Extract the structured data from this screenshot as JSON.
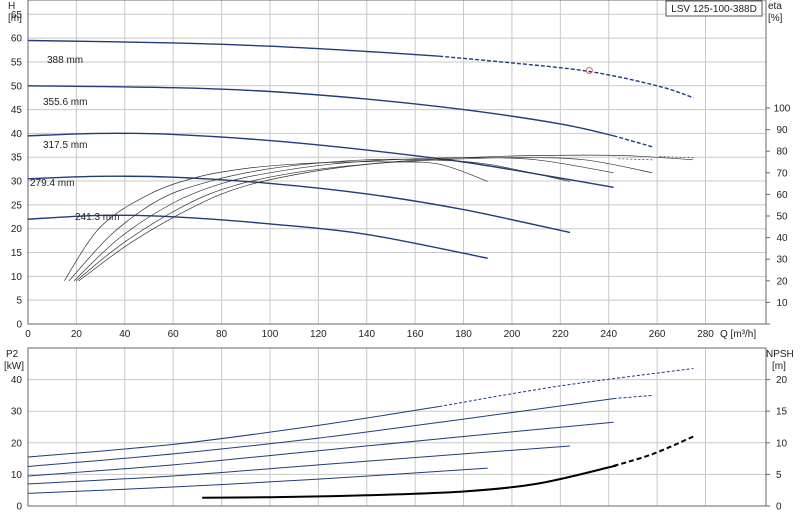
{
  "chart_title": "LSV 125-100-388D",
  "colors": {
    "curve": "#1f3d7a",
    "grid": "#c8c8c8",
    "eff": "#333333",
    "npsh": "#000000",
    "marker": "#e06060"
  },
  "top_axes": {
    "left_label": "H",
    "left_unit": "[m]",
    "right_label": "eta",
    "right_unit": "[%]",
    "x_label": "Q [m³/h]"
  },
  "bottom_axes": {
    "left_label": "P2",
    "left_unit": "[kW]",
    "right_label": "NPSH",
    "right_unit": "[m]"
  },
  "chart_data": [
    {
      "type": "line",
      "xlim": [
        0,
        305
      ],
      "ylim": [
        0,
        68
      ],
      "x_ticks": [
        "0",
        "20",
        "40",
        "60",
        "80",
        "100",
        "120",
        "140",
        "160",
        "180",
        "200",
        "220",
        "240",
        "260",
        "280"
      ],
      "y_ticks": [
        "0",
        "5",
        "10",
        "15",
        "20",
        "25",
        "30",
        "35",
        "40",
        "45",
        "50",
        "55",
        "60",
        "65"
      ],
      "eta_ticks": [
        "10",
        "20",
        "30",
        "40",
        "50",
        "60",
        "70",
        "80",
        "90",
        "100"
      ],
      "series": [
        {
          "name": "388 mm",
          "x": [
            0,
            60,
            100,
            140,
            170,
            200,
            232,
            260,
            275
          ],
          "y": [
            59.5,
            59,
            58.3,
            57.2,
            56.2,
            54.8,
            53,
            50,
            47.5
          ],
          "solid_until": 170
        },
        {
          "name": "355.6 mm",
          "x": [
            0,
            60,
            100,
            140,
            180,
            220,
            242,
            258
          ],
          "y": [
            50,
            49.6,
            48.8,
            47.2,
            45,
            42,
            39.5,
            37.2
          ],
          "solid_until": 242
        },
        {
          "name": "317.5 mm",
          "x": [
            0,
            30,
            60,
            100,
            140,
            180,
            210,
            242
          ],
          "y": [
            39.5,
            40,
            39.8,
            38.5,
            36.5,
            34,
            31.5,
            28.7
          ]
        },
        {
          "name": "279.4 mm",
          "x": [
            0,
            30,
            60,
            100,
            140,
            180,
            224
          ],
          "y": [
            30.5,
            31,
            30.8,
            29.5,
            27.3,
            24,
            19.2
          ]
        },
        {
          "name": "241.3 mm",
          "x": [
            0,
            30,
            60,
            100,
            140,
            190
          ],
          "y": [
            22,
            22.8,
            22.5,
            21,
            18.8,
            13.8
          ]
        }
      ],
      "efficiency_curves": [
        {
          "x": [
            15,
            30,
            50,
            70,
            90,
            110,
            130,
            150,
            170,
            190
          ],
          "eta": [
            20,
            45,
            60,
            68,
            72,
            74,
            75,
            75,
            74,
            66
          ]
        },
        {
          "x": [
            17,
            35,
            55,
            75,
            95,
            115,
            140,
            165,
            190,
            224
          ],
          "eta": [
            20,
            42,
            58,
            66,
            71,
            74,
            76,
            76,
            74,
            66
          ]
        },
        {
          "x": [
            19,
            38,
            60,
            80,
            100,
            125,
            150,
            180,
            210,
            242
          ],
          "eta": [
            20,
            40,
            56,
            65,
            70,
            74,
            76,
            77,
            76,
            70
          ]
        },
        {
          "x": [
            20,
            40,
            65,
            85,
            110,
            140,
            170,
            200,
            230,
            258
          ],
          "eta": [
            20,
            38,
            55,
            64,
            70,
            74,
            76,
            77,
            76,
            70
          ]
        },
        {
          "x": [
            21,
            43,
            68,
            90,
            120,
            150,
            180,
            210,
            245,
            275
          ],
          "eta": [
            20,
            38,
            54,
            64,
            71,
            75,
            77,
            78,
            78,
            76
          ]
        }
      ],
      "operating_point": {
        "x": 232,
        "y": 53.2
      }
    },
    {
      "type": "line",
      "xlim": [
        0,
        305
      ],
      "ylim": [
        0,
        50
      ],
      "y_ticks": [
        "0",
        "10",
        "20",
        "30",
        "40"
      ],
      "npsh_ticks": [
        "0",
        "5",
        "10",
        "15",
        "20"
      ],
      "power_curves": [
        {
          "x": [
            0,
            60,
            120,
            170,
            220,
            275
          ],
          "y": [
            15.5,
            19.5,
            25.5,
            31.5,
            38,
            43.5
          ],
          "solid_until": 170
        },
        {
          "x": [
            0,
            60,
            120,
            180,
            242,
            258
          ],
          "y": [
            12.5,
            16.5,
            21.5,
            27.5,
            34,
            35
          ],
          "solid_until": 242
        },
        {
          "x": [
            0,
            60,
            120,
            180,
            242
          ],
          "y": [
            9.5,
            13,
            17.5,
            22,
            26.5
          ]
        },
        {
          "x": [
            0,
            60,
            120,
            180,
            224
          ],
          "y": [
            7,
            9.5,
            13,
            16.5,
            19
          ]
        },
        {
          "x": [
            0,
            60,
            120,
            190
          ],
          "y": [
            4,
            6,
            8.5,
            12
          ]
        }
      ],
      "npsh_curve": {
        "x": [
          72,
          100,
          140,
          180,
          210,
          240,
          258,
          275
        ],
        "y": [
          1.3,
          1.4,
          1.7,
          2.3,
          3.5,
          6.1,
          8.2,
          11
        ],
        "solid_until": 242
      }
    }
  ]
}
